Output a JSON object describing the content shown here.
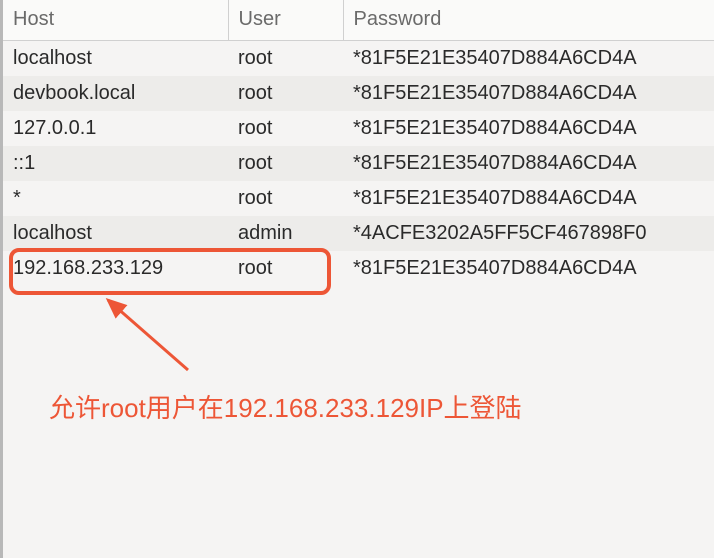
{
  "columns": {
    "host": "Host",
    "user": "User",
    "password": "Password"
  },
  "rows": [
    {
      "host": "localhost",
      "user": "root",
      "password": "*81F5E21E35407D884A6CD4A"
    },
    {
      "host": "devbook.local",
      "user": "root",
      "password": "*81F5E21E35407D884A6CD4A"
    },
    {
      "host": "127.0.0.1",
      "user": "root",
      "password": "*81F5E21E35407D884A6CD4A"
    },
    {
      "host": "::1",
      "user": "root",
      "password": "*81F5E21E35407D884A6CD4A"
    },
    {
      "host": "*",
      "user": "root",
      "password": "*81F5E21E35407D884A6CD4A"
    },
    {
      "host": "localhost",
      "user": "admin",
      "password": "*4ACFE3202A5FF5CF467898F0"
    },
    {
      "host": "192.168.233.129",
      "user": "root",
      "password": "*81F5E21E35407D884A6CD4A"
    }
  ],
  "annotation": "允许root用户在192.168.233.129IP上登陆",
  "highlight_color": "#ed5636"
}
